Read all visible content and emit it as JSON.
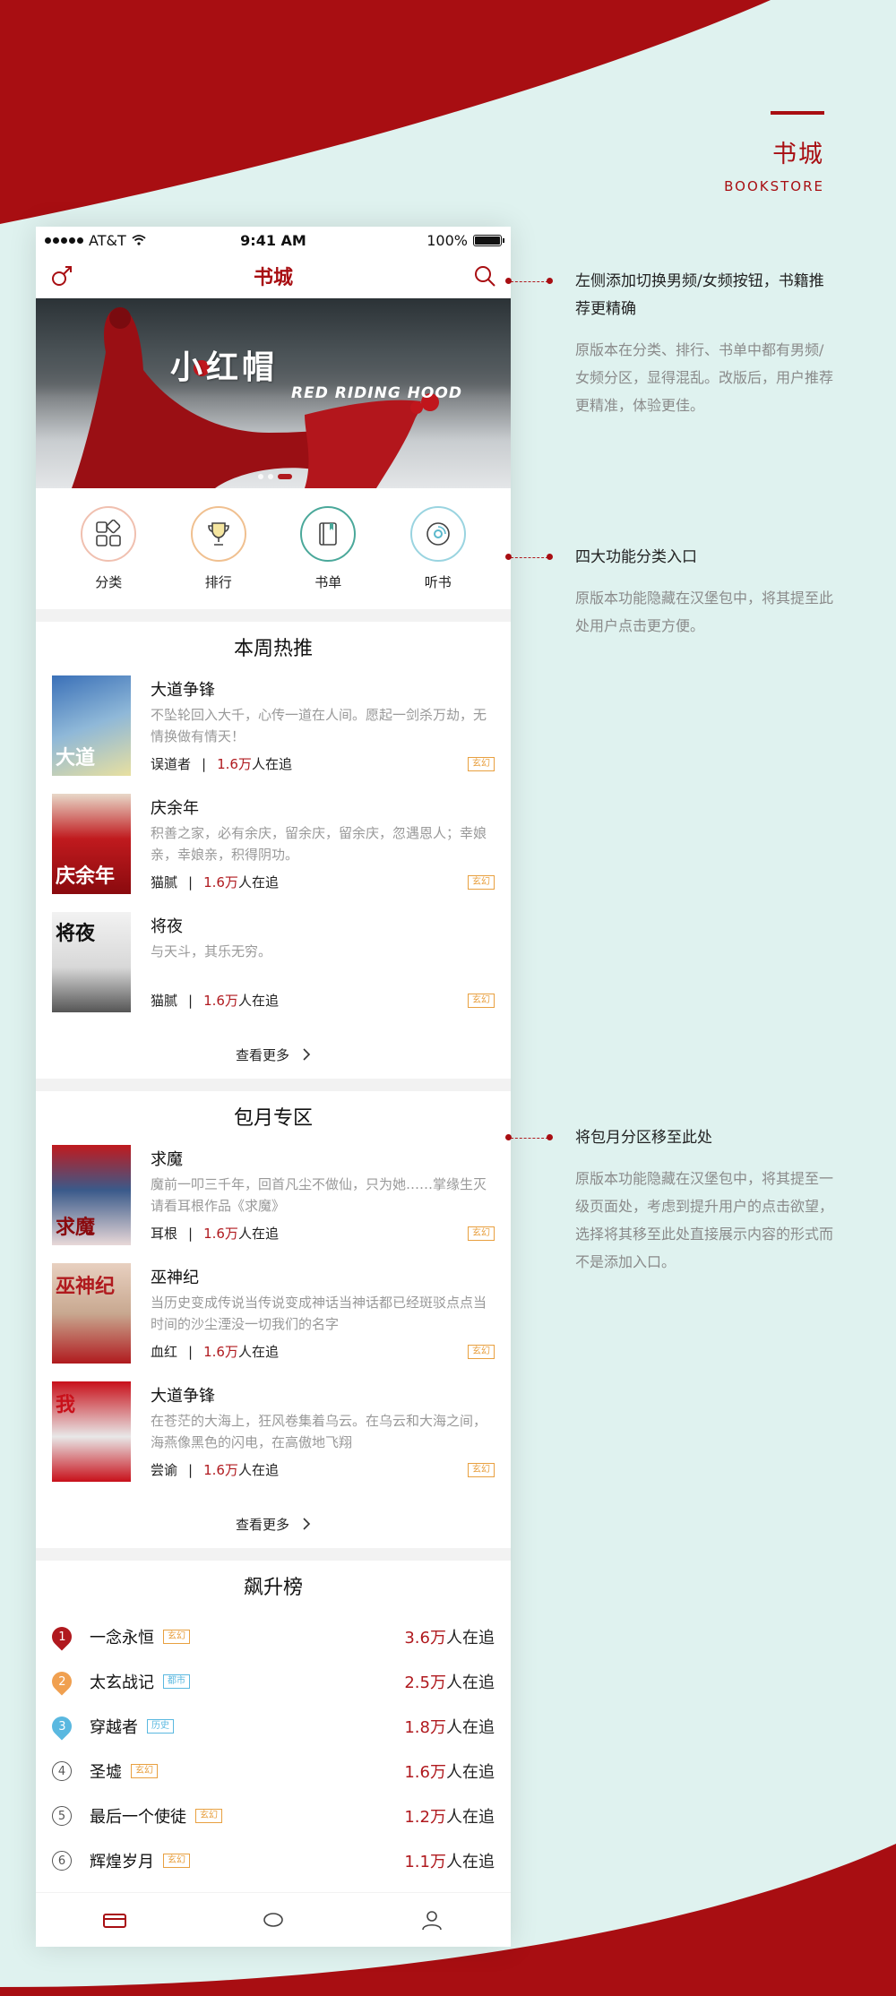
{
  "page": {
    "title_cn": "书城",
    "title_en": "BOOKSTORE",
    "accent": "#a80e12"
  },
  "status_bar": {
    "carrier": "AT&T",
    "time": "9:41 AM",
    "battery": "100%"
  },
  "nav": {
    "title": "书城",
    "left_icon": "male-gender-icon",
    "right_icon": "search-icon"
  },
  "banner": {
    "title_cn": "小红帽",
    "title_en": "RED RIDING HOOD",
    "dots": 3,
    "active_dot": 2
  },
  "categories": [
    {
      "label": "分类",
      "icon": "grid-icon",
      "color": "#e8a08a"
    },
    {
      "label": "排行",
      "icon": "trophy-icon",
      "color": "#e8b07a"
    },
    {
      "label": "书单",
      "icon": "book-icon",
      "color": "#4aa89a"
    },
    {
      "label": "听书",
      "icon": "disc-icon",
      "color": "#5ab8cc"
    }
  ],
  "weekly": {
    "title": "本周热推",
    "more": "查看更多",
    "books": [
      {
        "name": "大道争锋",
        "desc": "不坠轮回入大千，心传一道在人间。愿起一剑杀万劫，无情换做有情天！",
        "author": "误道者",
        "sep": "|",
        "count": "1.6万",
        "suffix": "人在追",
        "tag": "玄幻"
      },
      {
        "name": "庆余年",
        "desc": "积善之家，必有余庆，留余庆，留余庆，忽遇恩人；幸娘亲，幸娘亲，积得阴功。",
        "author": "猫腻",
        "sep": "|",
        "count": "1.6万",
        "suffix": "人在追",
        "tag": "玄幻"
      },
      {
        "name": "将夜",
        "desc": "与天斗，其乐无穷。",
        "author": "猫腻",
        "sep": "|",
        "count": "1.6万",
        "suffix": "人在追",
        "tag": "玄幻"
      }
    ]
  },
  "monthly": {
    "title": "包月专区",
    "more": "查看更多",
    "books": [
      {
        "name": "求魔",
        "desc": "魔前一叩三千年，回首凡尘不做仙，只为她……掌缘生灭请看耳根作品《求魔》",
        "author": "耳根",
        "sep": "|",
        "count": "1.6万",
        "suffix": "人在追",
        "tag": "玄幻"
      },
      {
        "name": "巫神纪",
        "desc": "当历史变成传说当传说变成神话当神话都已经斑驳点点当时间的沙尘湮没一切我们的名字",
        "author": "血红",
        "sep": "|",
        "count": "1.6万",
        "suffix": "人在追",
        "tag": "玄幻"
      },
      {
        "name": "大道争锋",
        "desc": "在苍茫的大海上，狂风卷集着乌云。在乌云和大海之间，海燕像黑色的闪电，在高傲地飞翔",
        "author": "尝谕",
        "sep": "|",
        "count": "1.6万",
        "suffix": "人在追",
        "tag": "玄幻"
      }
    ]
  },
  "rising": {
    "title": "飙升榜",
    "items": [
      {
        "rank": "1",
        "name": "一念永恒",
        "tag": "玄幻",
        "tag_color": "#e8a040",
        "count": "3.6万",
        "suffix": "人在追",
        "badge_color": "#b0191e"
      },
      {
        "rank": "2",
        "name": "太玄战记",
        "tag": "都市",
        "tag_color": "#5ab8e0",
        "count": "2.5万",
        "suffix": "人在追",
        "badge_color": "#f0a050"
      },
      {
        "rank": "3",
        "name": "穿越者",
        "tag": "历史",
        "tag_color": "#5ab8e0",
        "count": "1.8万",
        "suffix": "人在追",
        "badge_color": "#5ab8e0"
      },
      {
        "rank": "4",
        "name": "圣墟",
        "tag": "玄幻",
        "tag_color": "#e8a040",
        "count": "1.6万",
        "suffix": "人在追",
        "badge_color": ""
      },
      {
        "rank": "5",
        "name": "最后一个使徒",
        "tag": "玄幻",
        "tag_color": "#e8a040",
        "count": "1.2万",
        "suffix": "人在追",
        "badge_color": ""
      },
      {
        "rank": "6",
        "name": "辉煌岁月",
        "tag": "玄幻",
        "tag_color": "#e8a040",
        "count": "1.1万",
        "suffix": "人在追",
        "badge_color": ""
      }
    ]
  },
  "annotations": [
    {
      "title": "左侧添加切换男频/女频按钮，书籍推荐更精确",
      "desc": "原版本在分类、排行、书单中都有男频/女频分区，显得混乱。改版后，用户推荐更精准，体验更佳。"
    },
    {
      "title": "四大功能分类入口",
      "desc": "原版本功能隐藏在汉堡包中，将其提至此处用户点击更方便。"
    },
    {
      "title": "将包月分区移至此处",
      "desc": "原版本功能隐藏在汉堡包中，将其提至一级页面处，考虑到提升用户的点击欲望，选择将其移至此处直接展示内容的形式而不是添加入口。"
    }
  ]
}
